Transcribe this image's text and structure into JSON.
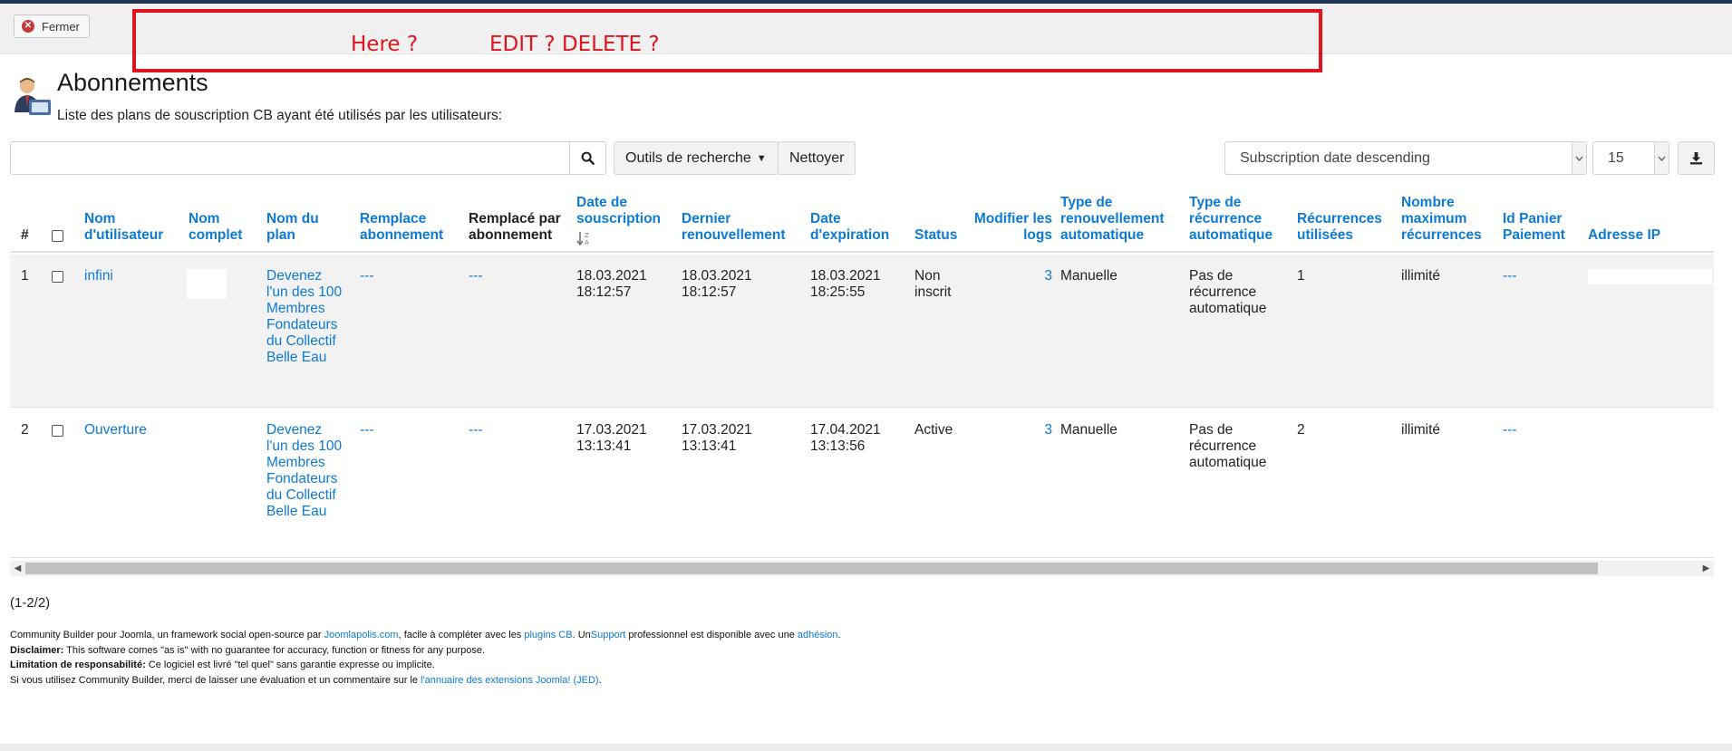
{
  "toolbar": {
    "close_label": "Fermer"
  },
  "annotations": {
    "here": "Here ?",
    "edit_delete": "EDIT ? DELETE ?"
  },
  "header": {
    "title": "Abonnements",
    "description": "Liste des plans de souscription CB ayant été utilisés par les utilisateurs:"
  },
  "search": {
    "placeholder": "",
    "tools_label": "Outils de recherche",
    "clear_label": "Nettoyer",
    "sort_value": "Subscription date descending",
    "limit_value": "15"
  },
  "table": {
    "columns": {
      "num": "#",
      "username": "Nom d'utilisateur",
      "fullname": "Nom complet",
      "plan": "Nom du plan",
      "replaces": "Remplace abonnement",
      "replaced_by": "Remplacé par abonnement",
      "sub_date": "Date de souscription",
      "last_renewal": "Dernier renouvellement",
      "expiry": "Date d'expiration",
      "status": "Status",
      "logs": "Modifier les logs",
      "renewal_type": "Type de renouvellement automatique",
      "recurrence_type": "Type de récurrence automatique",
      "recurrences_used": "Récurrences utilisées",
      "max_recurrences": "Nombre maximum récurrences",
      "basket_id": "Id Panier Paiement",
      "ip": "Adresse IP"
    },
    "rows": [
      {
        "num": "1",
        "username": "infini",
        "fullname": "",
        "plan": "Devenez l'un des 100 Membres Fondateurs du Collectif Belle Eau",
        "replaces": "---",
        "replaced_by": "---",
        "sub_date": "18.03.2021 18:12:57",
        "last_renewal": "18.03.2021 18:12:57",
        "expiry": "18.03.2021 18:25:55",
        "status": "Non inscrit",
        "logs": "3",
        "renewal_type": "Manuelle",
        "recurrence_type": "Pas de récurrence automatique",
        "recurrences_used": "1",
        "max_recurrences": "illimité",
        "basket_id": "---",
        "ip": ""
      },
      {
        "num": "2",
        "username": "Ouverture",
        "fullname": "",
        "plan": "Devenez l'un des 100 Membres Fondateurs du Collectif Belle Eau",
        "replaces": "---",
        "replaced_by": "---",
        "sub_date": "17.03.2021 13:13:41",
        "last_renewal": "17.03.2021 13:13:41",
        "expiry": "17.04.2021 13:13:56",
        "status": "Active",
        "logs": "3",
        "renewal_type": "Manuelle",
        "recurrence_type": "Pas de récurrence automatique",
        "recurrences_used": "2",
        "max_recurrences": "illimité",
        "basket_id": "---",
        "ip": ""
      }
    ]
  },
  "pagination": {
    "count": "(1-2/2)"
  },
  "footer": {
    "line1_a": "Community Builder pour Joomla, un framework social open-source par ",
    "line1_link1": "Joomlapolis.com",
    "line1_b": ", facile à compléter avec les ",
    "line1_link2": "plugins CB",
    "line1_c": ". Un",
    "line1_link3": "Support",
    "line1_d": " professionnel est disponible avec une ",
    "line1_link4": "adhésion",
    "line1_e": ".",
    "line2_label": "Disclaimer:",
    "line2_text": " This software comes \"as is\" with no guarantee for accuracy, function or fitness for any purpose.",
    "line3_label": "Limitation de responsabilité:",
    "line3_text": " Ce logiciel est livré \"tel quel\" sans garantie expresse ou implicite.",
    "line4_text": "Si vous utilisez Community Builder, merci de laisser une évaluation et un commentaire sur le ",
    "line4_link": "l'annuaire des extensions Joomla! (JED)",
    "line4_end": "."
  },
  "colors": {
    "link": "#0d7ad4",
    "annotation": "#e0141e",
    "top_strip": "#1f3355"
  }
}
